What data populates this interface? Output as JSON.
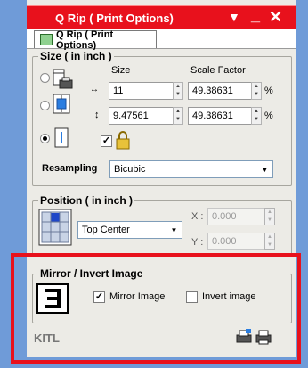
{
  "window": {
    "title": "Q Rip ( Print Options)"
  },
  "tab": {
    "label": "Q Rip ( Print Options)"
  },
  "size_group": {
    "label": "Size ( in inch )",
    "size_header": "Size",
    "scale_header": "Scale Factor",
    "width_value": "11",
    "height_value": "9.47561",
    "scale_w_value": "49.38631",
    "scale_h_value": "49.38631",
    "percent": "%",
    "resampling_label": "Resampling",
    "resampling_value": "Bicubic"
  },
  "position_group": {
    "label": "Position ( in inch )",
    "position_value": "Top Center",
    "x_label": "X :",
    "y_label": "Y :",
    "x_value": "0.000",
    "y_value": "0.000"
  },
  "mirror_group": {
    "label": "Mirror / Invert Image",
    "mirror_label": "Mirror Image",
    "invert_label": "Invert image",
    "mirror_checked": true,
    "invert_checked": false
  },
  "footer": {
    "logo_text": "KITL"
  },
  "colors": {
    "accent_red": "#e8111c",
    "background": "#6f9bd8"
  }
}
